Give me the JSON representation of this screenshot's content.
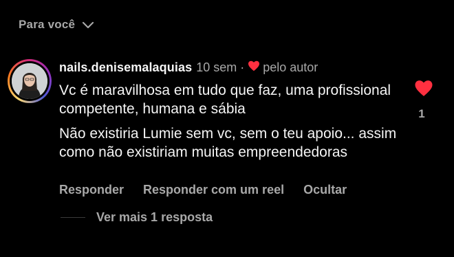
{
  "filter": {
    "label": "Para você",
    "icon": "chevron-down-icon"
  },
  "comment": {
    "avatar_icon": "user-avatar",
    "username": "nails.denisemalaquias",
    "age": "10 sem",
    "separator": "·",
    "liked_by_author_icon": "heart-icon",
    "liked_by_author_label": "pelo autor",
    "paragraphs": [
      "Vc é maravilhosa em tudo que faz, uma profissional competente, humana e sábia",
      "Não existiria Lumie sem vc, sem o teu apoio... assim como não existiriam muitas empreendedoras"
    ],
    "like_icon": "heart-icon",
    "like_count": "1",
    "actions": {
      "reply": "Responder",
      "reply_with_reel": "Responder com um reel",
      "hide": "Ocultar"
    },
    "view_replies": "Ver mais 1 resposta"
  },
  "colors": {
    "background": "#000000",
    "primary_text": "#f5f5f5",
    "secondary_text": "#a8a8a8",
    "heart": "#ff3040"
  }
}
